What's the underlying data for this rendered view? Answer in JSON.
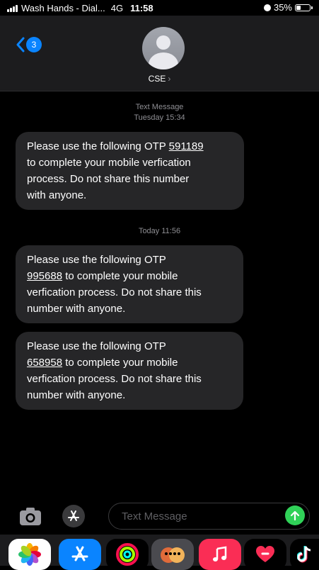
{
  "status_bar": {
    "carrier": "Wash Hands - Dial...",
    "network": "4G",
    "time": "11:58",
    "battery_percent": "35%",
    "battery_level": 0.35,
    "icons": [
      "signal-icon",
      "alarm-icon",
      "battery-icon"
    ]
  },
  "header": {
    "back_badge_count": "3",
    "contact_name": "CSE",
    "contact_chevron": "›"
  },
  "messages": {
    "first_group_label": "Text Message",
    "first_group_time": "Tuesday 15:34",
    "second_group_time": "Today 11:56",
    "items": [
      {
        "lines": [
          {
            "pre": "Please use the following OTP ",
            "otp": "591189",
            "post": ""
          },
          {
            "pre": "to complete your mobile verfication",
            "otp": "",
            "post": ""
          },
          {
            "pre": "process. Do not share this number",
            "otp": "",
            "post": ""
          },
          {
            "pre": "with anyone.",
            "otp": "",
            "post": ""
          }
        ]
      },
      {
        "lines": [
          {
            "pre": "Please use the following OTP",
            "otp": "",
            "post": ""
          },
          {
            "pre": "",
            "otp": "995688",
            "post": " to complete your mobile"
          },
          {
            "pre": "verfication process. Do not share this",
            "otp": "",
            "post": ""
          },
          {
            "pre": "number with anyone.",
            "otp": "",
            "post": ""
          }
        ]
      },
      {
        "lines": [
          {
            "pre": "Please use the following OTP",
            "otp": "",
            "post": ""
          },
          {
            "pre": "",
            "otp": "658958",
            "post": " to complete your mobile"
          },
          {
            "pre": "verfication process. Do not share this",
            "otp": "",
            "post": ""
          },
          {
            "pre": "number with anyone.",
            "otp": "",
            "post": ""
          }
        ]
      }
    ]
  },
  "input_bar": {
    "placeholder": "Text Message"
  },
  "app_drawer": {
    "apps": [
      "photos-app-icon",
      "app-store-icon",
      "activity-app-icon",
      "memoji-app-icon",
      "music-app-icon",
      "heart-app-icon",
      "tiktok-app-icon"
    ],
    "colors": {
      "app_store": "#0a84ff",
      "music": "#fa2d55",
      "heart": "#1c1c1e",
      "send": "#30d158"
    }
  }
}
